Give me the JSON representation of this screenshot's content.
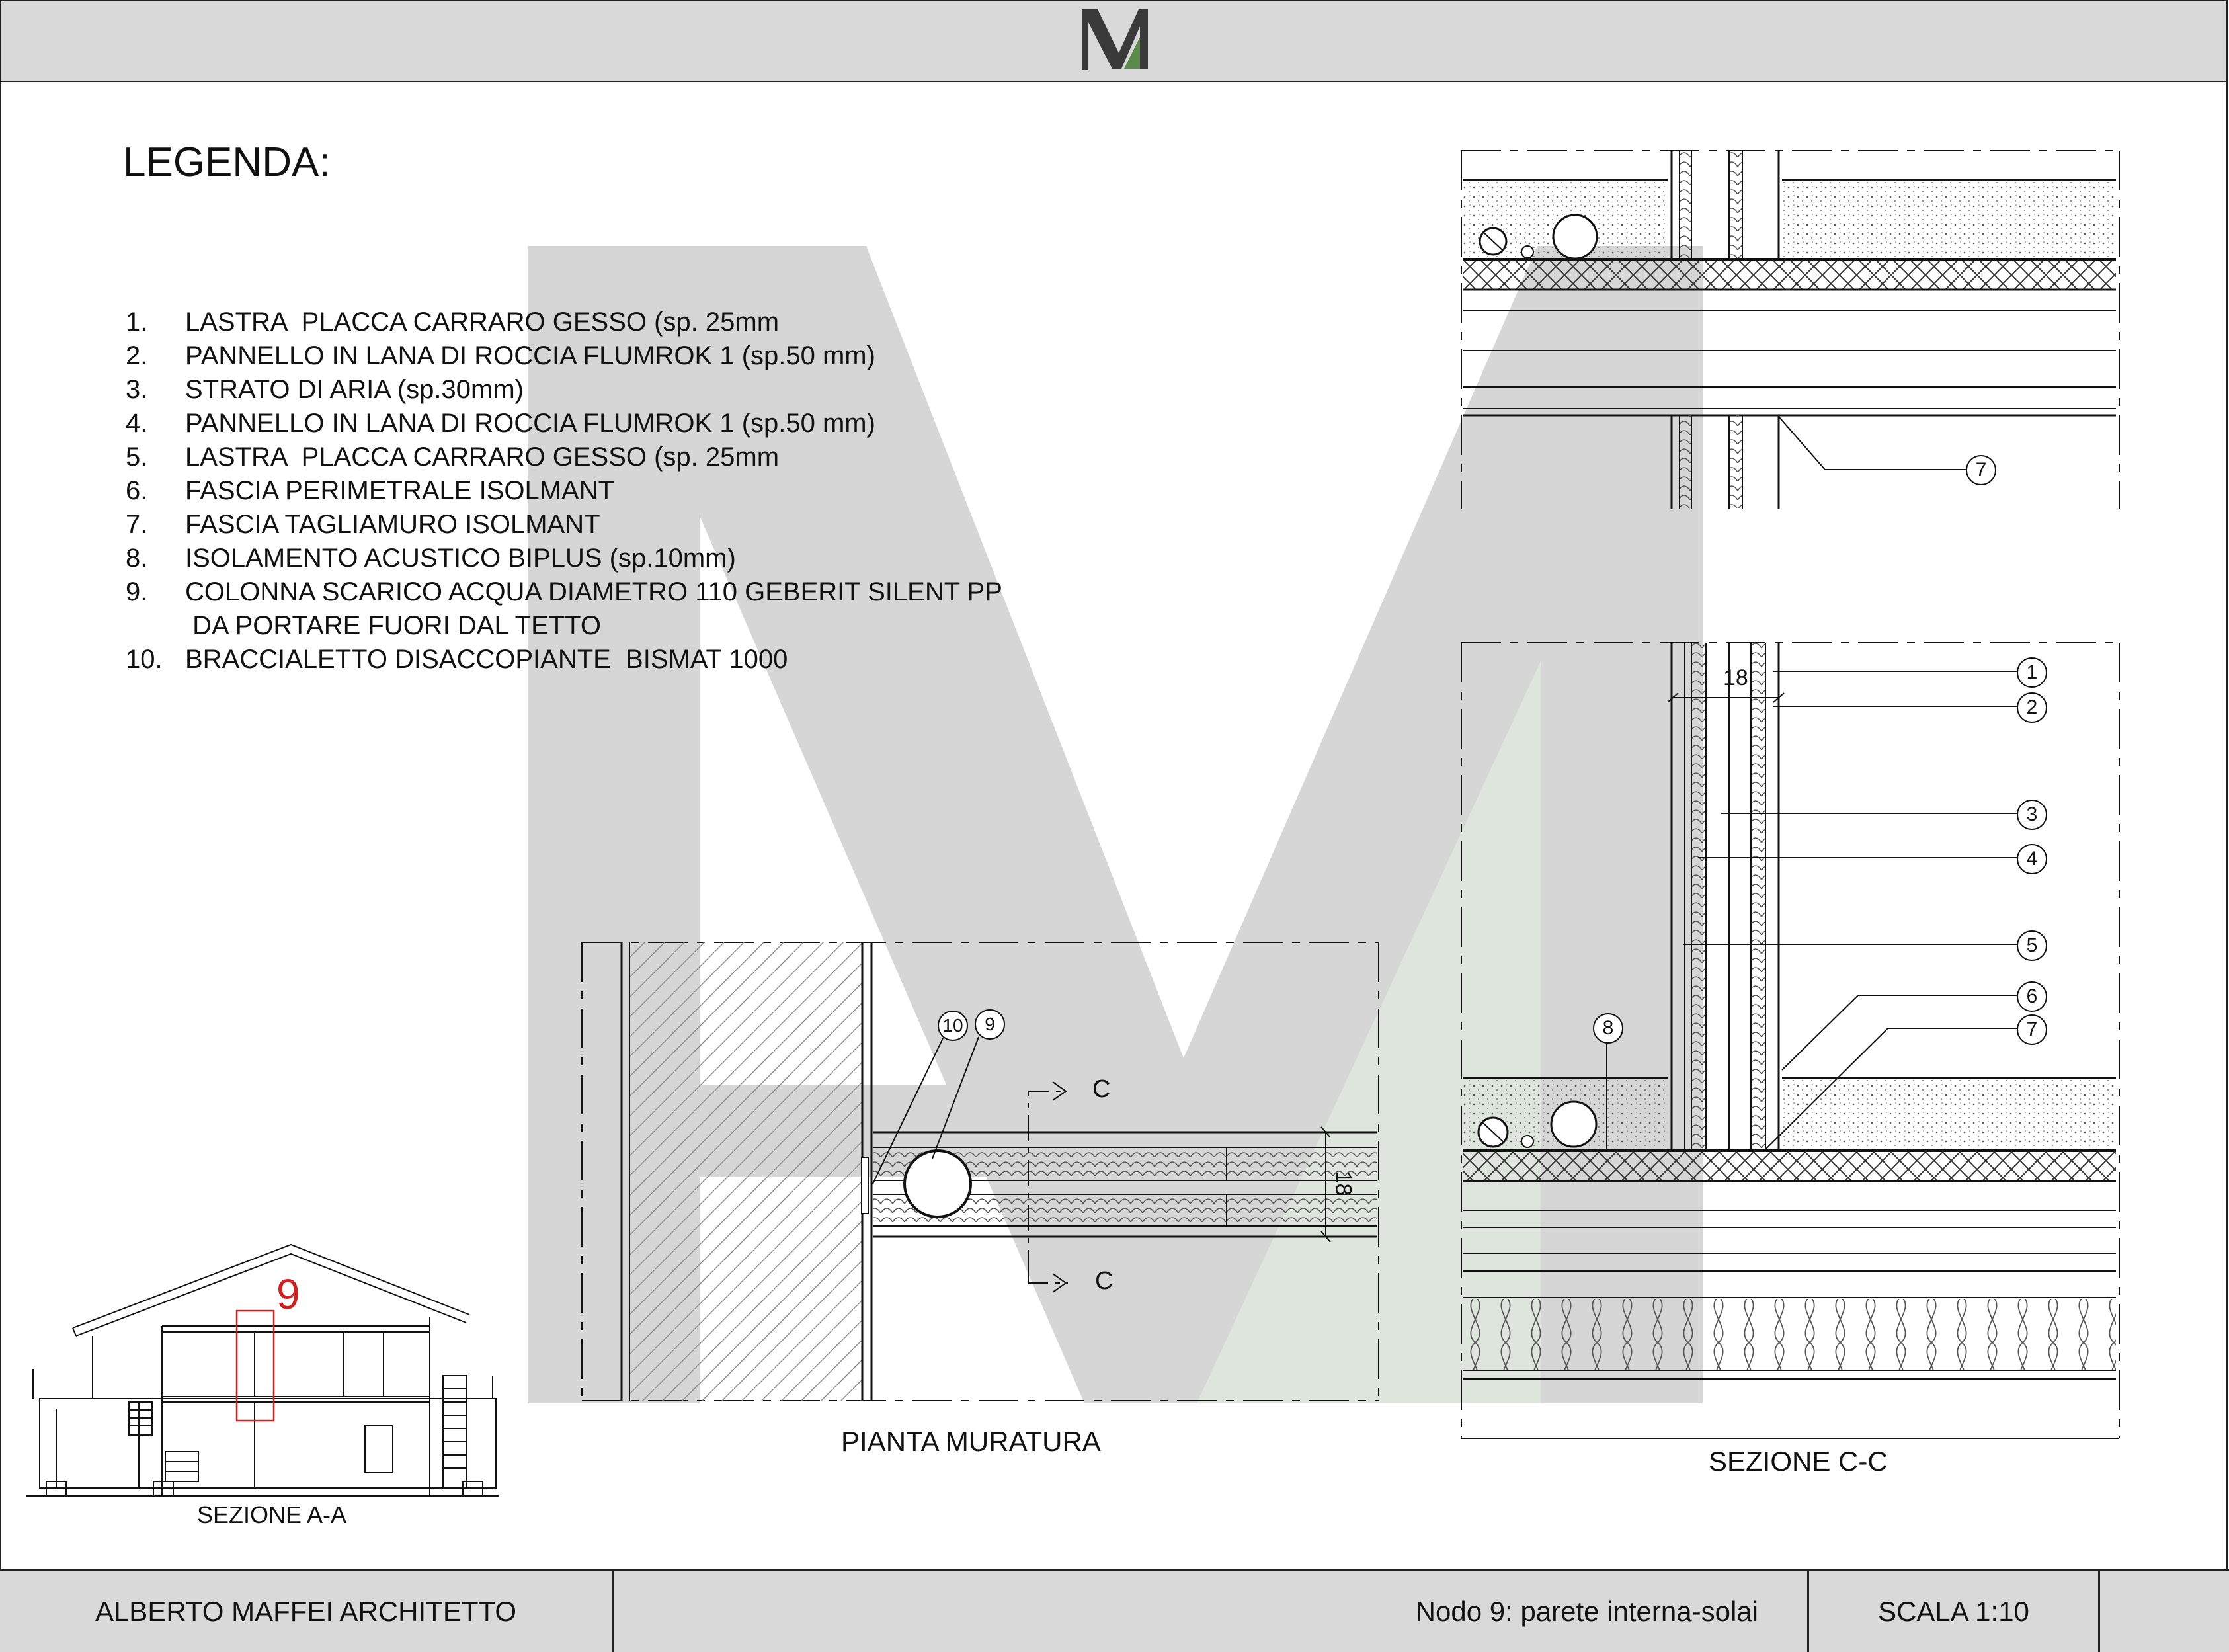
{
  "header": {
    "logo_letters": "M"
  },
  "legend": {
    "title": "LEGENDA:",
    "items": [
      {
        "num": "1.",
        "text": "LASTRA  PLACCA CARRARO GESSO (sp. 25mm"
      },
      {
        "num": "2.",
        "text": "PANNELLO IN LANA DI ROCCIA FLUMROK 1 (sp.50 mm)"
      },
      {
        "num": "3.",
        "text": "STRATO DI ARIA (sp.30mm)"
      },
      {
        "num": "4.",
        "text": "PANNELLO IN LANA DI ROCCIA FLUMROK 1 (sp.50 mm)"
      },
      {
        "num": "5.",
        "text": "LASTRA  PLACCA CARRARO GESSO (sp. 25mm"
      },
      {
        "num": "6.",
        "text": "FASCIA PERIMETRALE ISOLMANT"
      },
      {
        "num": "7.",
        "text": "FASCIA TAGLIAMURO ISOLMANT"
      },
      {
        "num": "8.",
        "text": "ISOLAMENTO ACUSTICO BIPLUS (sp.10mm)"
      },
      {
        "num": "9.",
        "text": "COLONNA SCARICO ACQUA DIAMETRO 110 GEBERIT SILENT PP"
      },
      {
        "num": "",
        "text": " DA PORTARE FUORI DAL TETTO"
      },
      {
        "num": "10.",
        "text": "BRACCIALETTO DISACCOPIANTE  BISMAT 1000"
      }
    ]
  },
  "drawings": {
    "pianta": {
      "caption": "PIANTA MURATURA",
      "markers": [
        "10",
        "9"
      ],
      "section_mark": "C",
      "dimension": "18"
    },
    "sezione_cc": {
      "caption": "SEZIONE C-C",
      "markers": [
        "1",
        "2",
        "3",
        "4",
        "5",
        "6",
        "7",
        "8",
        "7"
      ],
      "dimension": "18"
    },
    "sezione_aa": {
      "caption": "SEZIONE A-A",
      "node_label": "9"
    }
  },
  "colors": {
    "watermark_grey": "#d6d6d6",
    "watermark_green": "#dde5dc",
    "node_red": "#cc2222",
    "logo_green": "#5c8a4a"
  },
  "footer": {
    "author": "ALBERTO MAFFEI ARCHITETTO",
    "title": "Nodo 9: parete interna-solai",
    "scale": "SCALA 1:10",
    "extra": ""
  }
}
